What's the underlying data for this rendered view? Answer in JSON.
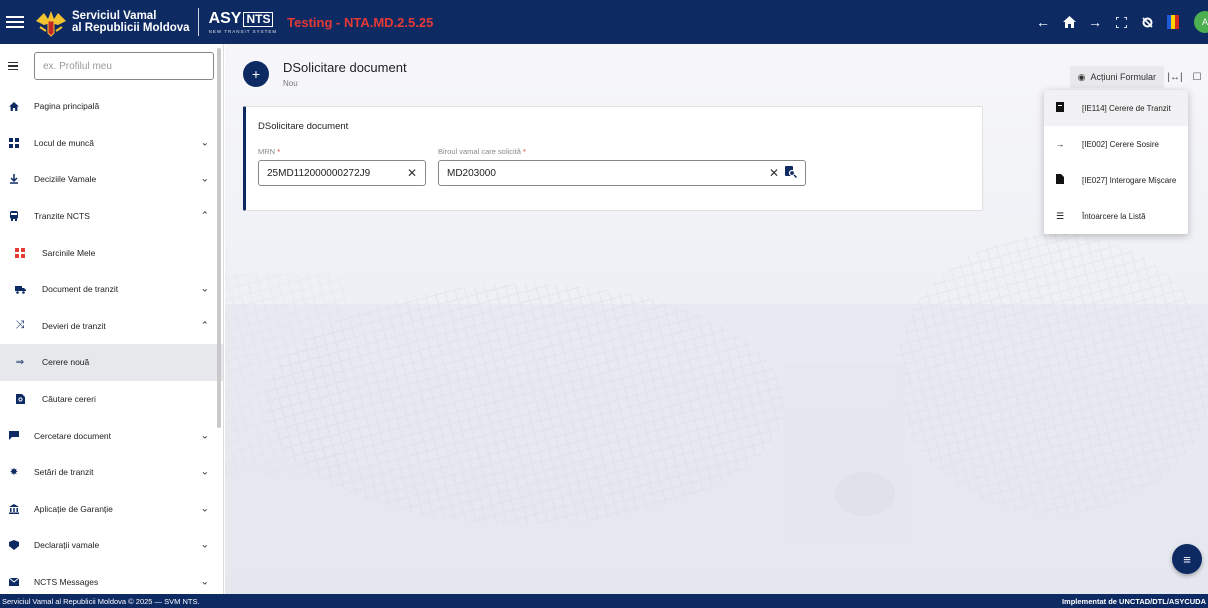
{
  "header": {
    "org_line1": "Serviciul Vamal",
    "org_line2": "al Republicii Moldova",
    "product": "ASY",
    "product_badge": "NTS",
    "product_sub": "NEW TRANSIT SYSTEM",
    "env_title": "Testing - NTA.MD.2.5.25",
    "icons": [
      "arrow-left-icon",
      "home-icon",
      "arrow-right-icon",
      "fullscreen-icon",
      "settings-icon",
      "flag-icon",
      "avatar"
    ],
    "avatar_initial": "A",
    "env_color": "#e53935",
    "brand_color": "#0e2a63"
  },
  "sidebar": {
    "search_placeholder": "ex. Profilul meu",
    "items": [
      {
        "label": "Pagina principală",
        "icon": "home-icon"
      },
      {
        "label": "Locul de muncă",
        "icon": "grid-icon",
        "chevron": "down"
      },
      {
        "label": "Deciziile Vamale",
        "icon": "gavel-icon",
        "chevron": "down"
      },
      {
        "label": "Tranzite NCTS",
        "icon": "bus-icon",
        "chevron": "up"
      },
      {
        "label": "Sarcinile Mele",
        "icon": "tasks-icon"
      },
      {
        "label": "Document de tranzit",
        "icon": "truck-icon",
        "chevron": "down"
      },
      {
        "label": "Devieri de tranzit",
        "icon": "shuffle-icon",
        "chevron": "up"
      },
      {
        "label": "Cerere nouă",
        "icon": "arrow-right-icon"
      },
      {
        "label": "Căutare cereri",
        "icon": "file-search-icon"
      },
      {
        "label": "Cercetare document",
        "icon": "comment-icon",
        "chevron": "down"
      },
      {
        "label": "Setări de tranzit",
        "icon": "gear-icon",
        "chevron": "down"
      },
      {
        "label": "Aplicație de Garanție",
        "icon": "bank-icon",
        "chevron": "down"
      },
      {
        "label": "Declarații vamale",
        "icon": "badge-icon",
        "chevron": "down"
      },
      {
        "label": "NCTS Messages",
        "icon": "mail-icon",
        "chevron": "down"
      }
    ]
  },
  "page": {
    "title": "DSolicitare document",
    "subtitle": "Nou",
    "card_title": "DSolicitare document",
    "mrn_label": "MRN",
    "mrn_value": "25MD112000000272J9",
    "office_label": "Biroul vamal care solicită",
    "office_value": "MD203000",
    "required_mark": "*"
  },
  "actions": {
    "button_label": "Acțiuni Formular",
    "menu": [
      {
        "label": "[IE114] Cerere de Tranzit",
        "icon": "document-icon"
      },
      {
        "label": "[IE002] Cerere Sosire",
        "icon": "arrow-right-icon"
      },
      {
        "label": "[IE027] Interogare Mișcare",
        "icon": "file-icon"
      },
      {
        "label": "Întoarcere la Listă",
        "icon": "list-icon"
      }
    ]
  },
  "footer": {
    "left": "Serviciul Vamal al Republicii Moldova © 2025 — SVM NTS.",
    "right": "Implementat de UNCTAD/DTL/ASYCUDA"
  }
}
